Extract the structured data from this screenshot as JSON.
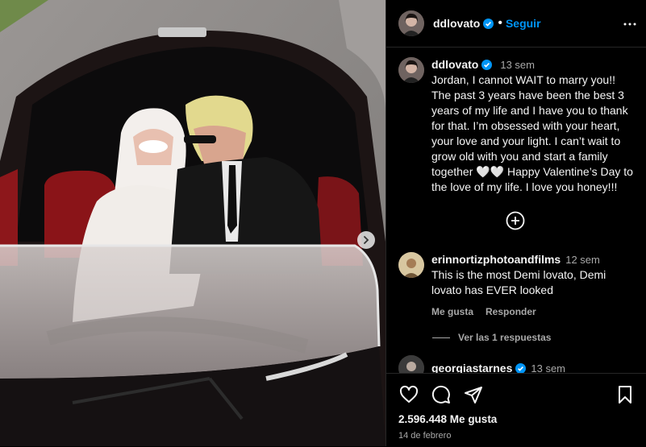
{
  "post": {
    "username": "ddlovato",
    "follow_label": "Seguir",
    "caption": {
      "username": "ddlovato",
      "time": "13 sem",
      "text": "Jordan, I cannot WAIT to marry you!! The past 3 years have been the best 3 years of my life and I have you to thank for that. I’m obsessed with your heart, your love and your light. I can’t wait to grow old with you and start a family together 🤍🤍 Happy Valentine’s Day to the love of my life. I love you honey!!!"
    },
    "comments": [
      {
        "username": "erinnortizphotoandfilms",
        "time": "12 sem",
        "text": "This is the most Demi lovato, Demi lovato has EVER looked",
        "like_label": "Me gusta",
        "reply_label": "Responder",
        "view_replies": "Ver las 1 respuestas"
      },
      {
        "username": "georgiastarnes",
        "time": "13 sem"
      }
    ],
    "likes": "2.596.448 Me gusta",
    "date": "14 de febrero"
  },
  "colors": {
    "accent": "#0095f6",
    "verified": "#0095f6",
    "secondary_text": "#a8a8a8",
    "border": "#262626"
  },
  "icons": [
    "chevron-right-icon",
    "verified-icon",
    "more-options-icon",
    "add-circle-icon",
    "heart-icon",
    "comment-icon",
    "share-icon",
    "bookmark-icon"
  ]
}
